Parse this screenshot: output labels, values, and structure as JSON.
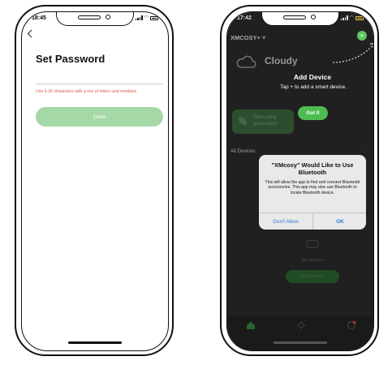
{
  "left_phone": {
    "status_time": "18:45",
    "back_icon": "chevron-left-icon",
    "title": "Set Password",
    "password_placeholder": "",
    "hint": "Use 6-20 characters with a mix of letters and numbers",
    "done_label": "Done",
    "done_color": "#a4d8a6",
    "hint_color": "#d85b4b"
  },
  "right_phone": {
    "status_time": "17:42",
    "home_name": "XMCOSY+ ˅",
    "weather": {
      "condition": "Cloudy",
      "icon": "cloud-icon"
    },
    "coach_mark": {
      "title": "Add Device",
      "subtitle": "Tap + to add a smart device.",
      "got_it_label": "Got It"
    },
    "automation_text": "Start using automation",
    "all_devices_label": "All Devices",
    "bluetooth_dialog": {
      "title": "\"XMcosy\" Would Like to Use Bluetooth",
      "message": "This will allow the app to find and connect Bluetooth accessories. This app may also use Bluetooth to locate Bluetooth device.",
      "deny_label": "Don't Allow",
      "ok_label": "OK"
    },
    "no_devices_text": "No devices",
    "add_device_label": "Add Device",
    "accent_color": "#4ebd51",
    "tabs": [
      {
        "icon": "home-icon"
      },
      {
        "icon": "scene-icon"
      },
      {
        "icon": "profile-icon"
      }
    ]
  }
}
